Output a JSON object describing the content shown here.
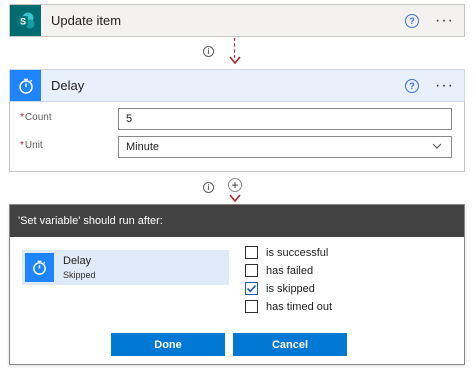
{
  "update_card": {
    "title": "Update item"
  },
  "delay_card": {
    "title": "Delay",
    "fields": [
      {
        "label": "Count",
        "value": "5"
      },
      {
        "label": "Unit",
        "value": "Minute"
      }
    ]
  },
  "dialog": {
    "title": "'Set variable' should run after:",
    "action": {
      "name": "Delay",
      "status": "Skipped"
    },
    "conditions": [
      {
        "label": "is successful",
        "checked": false
      },
      {
        "label": "has failed",
        "checked": false
      },
      {
        "label": "is skipped",
        "checked": true
      },
      {
        "label": "has timed out",
        "checked": false
      }
    ],
    "done_label": "Done",
    "cancel_label": "Cancel"
  },
  "colors": {
    "sharepoint_tile": "#036c70",
    "delay_tile": "#1f85ff",
    "primary_button": "#0078d4",
    "connector": "#a4262c",
    "dialog_header": "#424242"
  },
  "icons": {
    "sharepoint": "sharepoint-icon",
    "timer": "timer-icon",
    "help": "help-icon",
    "more": "more-icon",
    "info": "info-icon",
    "add": "plus-icon",
    "chevron": "chevron-down-icon",
    "check": "check-icon"
  }
}
